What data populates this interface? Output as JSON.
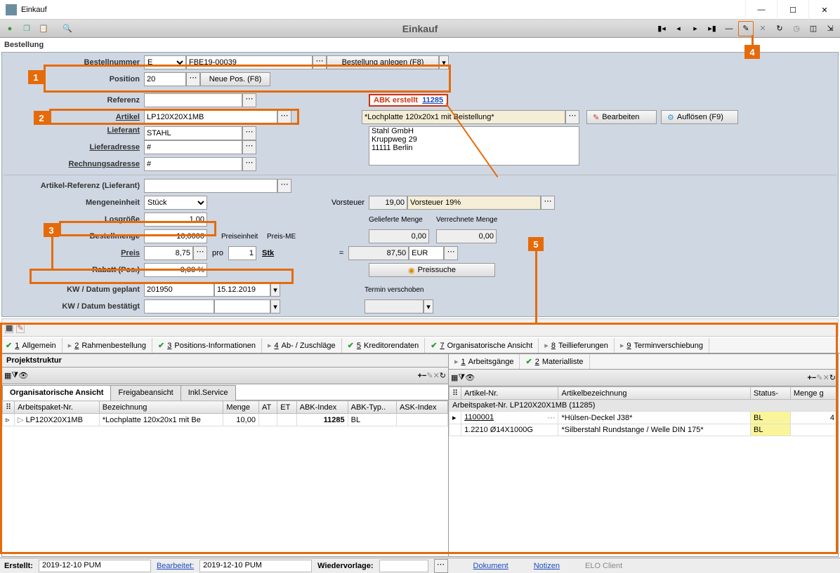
{
  "window": {
    "title": "Einkauf"
  },
  "toolbar": {
    "title": "Einkauf"
  },
  "section": "Bestellung",
  "bestellnummer": {
    "label": "Bestellnummer",
    "prefix": "E",
    "value": "FBE19-00039",
    "create_btn": "Bestellung anlegen (F8)"
  },
  "position": {
    "label": "Position",
    "value": "20",
    "new_btn": "Neue Pos. (F8)"
  },
  "referenz": {
    "label": "Referenz",
    "value": ""
  },
  "abk": {
    "label": "ABK erstellt",
    "link": "11285"
  },
  "artikel": {
    "label": "Artikel",
    "value": "LP120X20X1MB",
    "desc": "*Lochplatte 120x20x1 mit Beistellung*",
    "bearbeiten": "Bearbeiten",
    "aufloesen": "Auflösen (F9)"
  },
  "lieferant": {
    "label": "Lieferant",
    "value": "STAHL",
    "address": "Stahl GmbH\nKruppweg 29\n11111 Berlin"
  },
  "lieferadresse": {
    "label": "Lieferadresse",
    "value": "#"
  },
  "rechnungsadresse": {
    "label": "Rechnungsadresse",
    "value": "#"
  },
  "artref": {
    "label": "Artikel-Referenz (Lieferant)",
    "value": ""
  },
  "mengeneinheit": {
    "label": "Mengeneinheit",
    "value": "Stück"
  },
  "vorsteuer": {
    "label": "Vorsteuer",
    "value": "19,00",
    "text": "Vorsteuer 19%"
  },
  "losgroesse": {
    "label": "Losgröße",
    "value": "1,00"
  },
  "gelieferte": {
    "label": "Gelieferte Menge",
    "value": "0,00"
  },
  "verrechnete": {
    "label": "Verrechnete Menge",
    "value": "0,00"
  },
  "bestellmenge": {
    "label": "Bestellmenge",
    "value": "10,0000"
  },
  "preiseinheit_label": "Preiseinheit",
  "preisme_label": "Preis-ME",
  "preis": {
    "label": "Preis",
    "value": "8,75",
    "pro": "pro",
    "pe": "1",
    "me": "Stk",
    "eq": "=",
    "sum": "87,50",
    "cur": "EUR"
  },
  "rabatt": {
    "label": "Rabatt (Pos.)",
    "value": "0,00 %"
  },
  "preissuche": "Preissuche",
  "kwgeplant": {
    "label": "KW / Datum geplant",
    "kw": "201950",
    "datum": "15.12.2019"
  },
  "kwbest": {
    "label": "KW / Datum bestätigt",
    "kw": "",
    "datum": ""
  },
  "termin_verschoben": "Termin verschoben",
  "main_tabs": [
    {
      "icon": "check",
      "num": "1",
      "label": "Allgemein"
    },
    {
      "icon": "arrow",
      "num": "2",
      "label": "Rahmenbestellung"
    },
    {
      "icon": "check",
      "num": "3",
      "label": "Positions-Informationen"
    },
    {
      "icon": "arrow",
      "num": "4",
      "label": "Ab- / Zuschläge"
    },
    {
      "icon": "check",
      "num": "5",
      "label": "Kreditorendaten"
    },
    {
      "icon": "check",
      "num": "7",
      "label": "Organisatorische Ansicht"
    },
    {
      "icon": "arrow",
      "num": "8",
      "label": "Teillieferungen"
    },
    {
      "icon": "arrow",
      "num": "9",
      "label": "Terminverschiebung"
    }
  ],
  "left_pane": {
    "header": "Projektstruktur",
    "sub_tabs": [
      "Organisatorische Ansicht",
      "Freigabeansicht",
      "Inkl.Service"
    ],
    "cols": [
      "Arbeitspaket-Nr.",
      "Bezeichnung",
      "Menge",
      "AT",
      "ET",
      "ABK-Index",
      "ABK-Typ..",
      "ASK-Index"
    ],
    "row": {
      "ap": "LP120X20X1MB",
      "bez": "*Lochplatte 120x20x1 mit Be",
      "menge": "10,00",
      "abki": "11285",
      "abkt": "BL"
    }
  },
  "right_pane": {
    "sub_tabs": [
      {
        "num": "1",
        "label": "Arbeitsgänge"
      },
      {
        "num": "2",
        "label": "Materialliste"
      }
    ],
    "cols": [
      "Artikel-Nr.",
      "Artikelbezeichnung",
      "Status-",
      "Menge g"
    ],
    "group": "Arbeitspaket-Nr. LP120X20X1MB (11285)",
    "rows": [
      {
        "nr": "1100001",
        "bez": "*Hülsen-Deckel J38*",
        "status": "BL",
        "m": "4"
      },
      {
        "nr": "1.2210 Ø14X1000G",
        "bez": "*Silberstahl Rundstange / Welle DIN 175*",
        "status": "BL",
        "m": ""
      }
    ]
  },
  "footer": {
    "erstellt_l": "Erstellt:",
    "erstellt": "2019-12-10  PUM",
    "bearbeitet_l": "Bearbeitet:",
    "bearbeitet": "2019-12-10  PUM",
    "wieder_l": "Wiedervorlage:",
    "dokument": "Dokument",
    "notizen": "Notizen",
    "elo": "ELO Client"
  },
  "callouts": {
    "c1": "1",
    "c2": "2",
    "c3": "3",
    "c4": "4",
    "c5": "5"
  }
}
